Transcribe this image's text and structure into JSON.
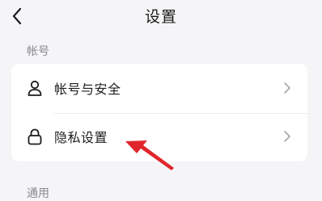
{
  "header": {
    "title": "设置",
    "back_icon": "chevron-left-icon"
  },
  "sections": [
    {
      "label": "帐号",
      "items": [
        {
          "label": "帐号与安全",
          "icon": "user-icon"
        },
        {
          "label": "隐私设置",
          "icon": "lock-icon"
        }
      ]
    },
    {
      "label": "通用"
    }
  ],
  "colors": {
    "background": "#f5f5f7",
    "card": "#ffffff",
    "annotation_arrow": "#e0262b",
    "secondary_text": "#8a8a8e"
  }
}
